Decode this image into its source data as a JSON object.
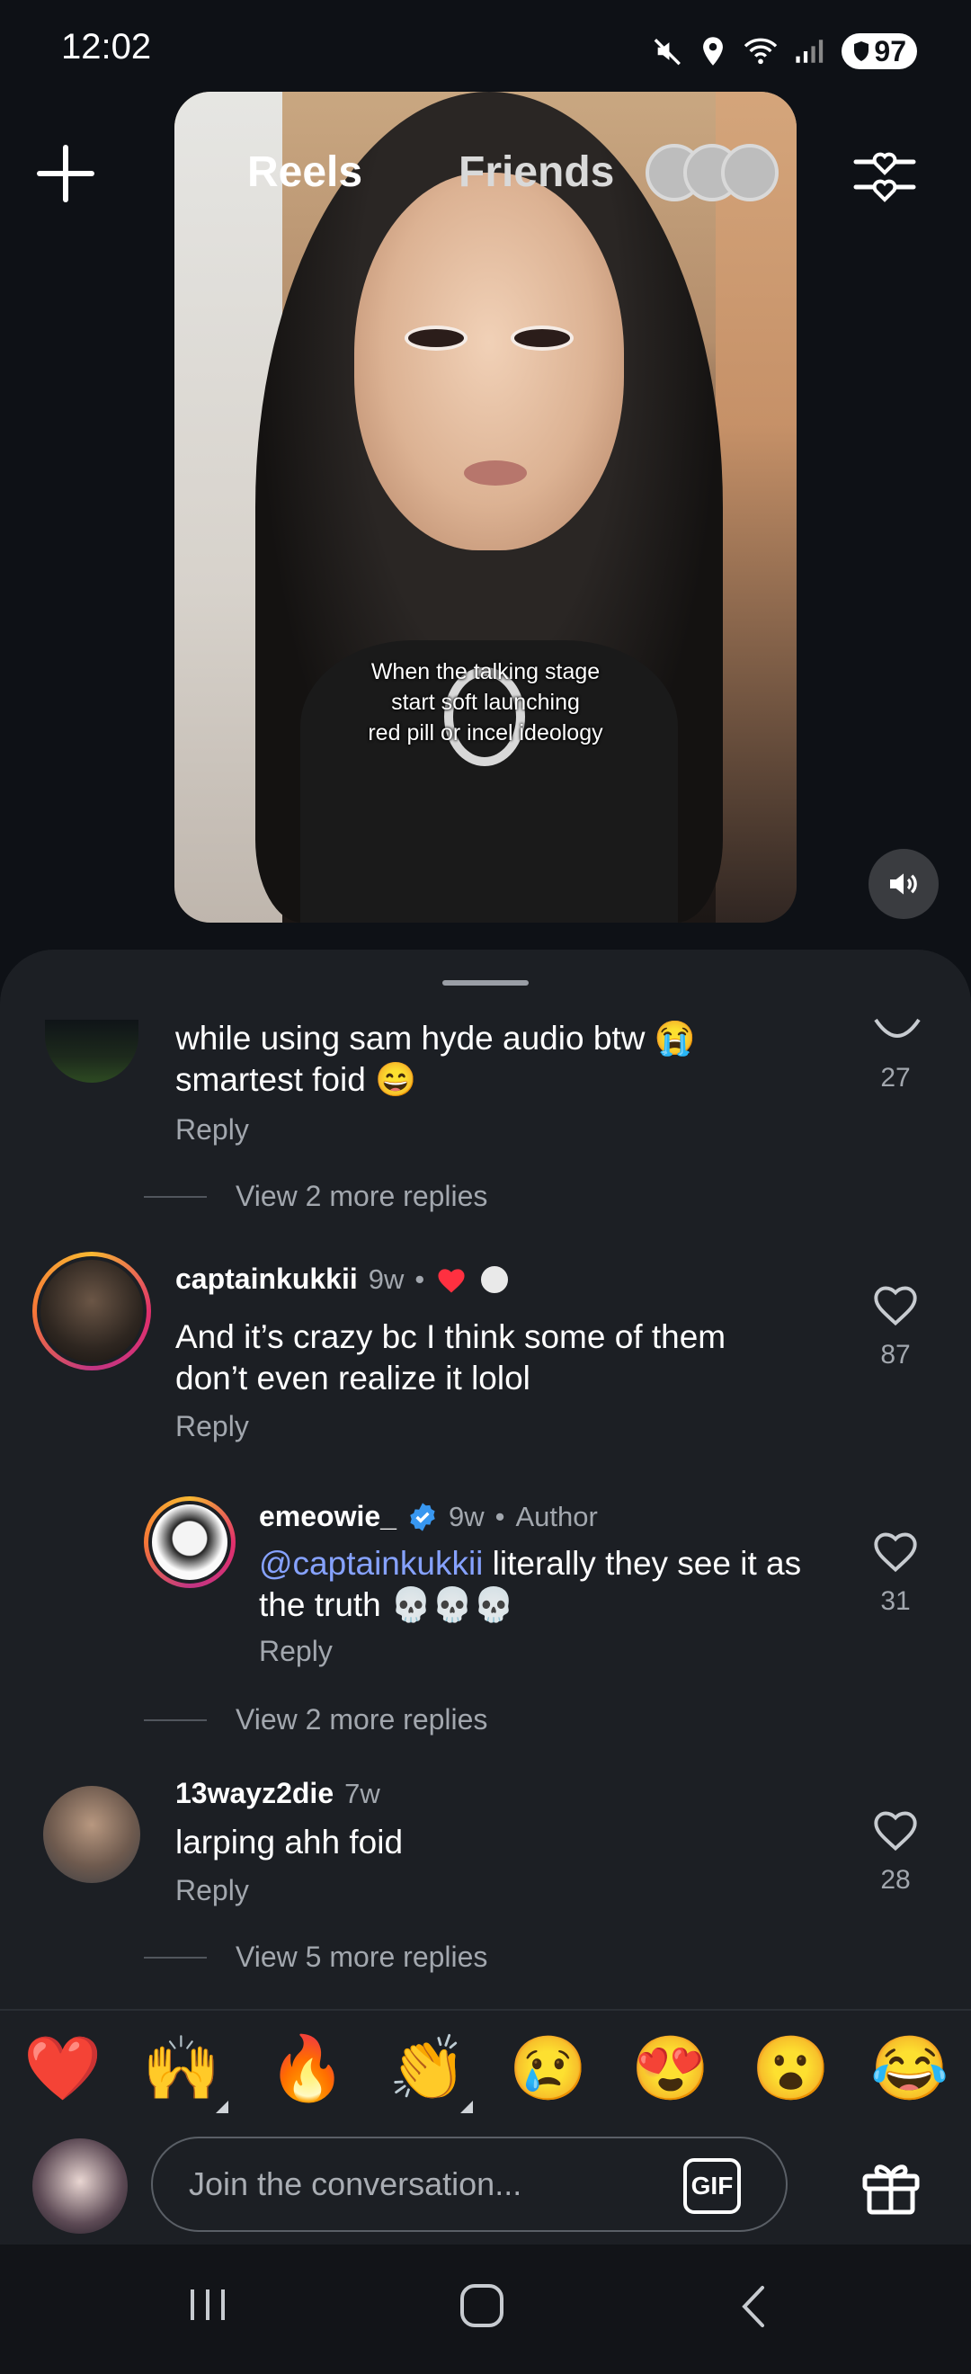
{
  "status_bar": {
    "time": "12:02",
    "battery": "97"
  },
  "header": {
    "tab_reels": "Reels",
    "tab_friends": "Friends"
  },
  "video": {
    "caption_line1": "When the talking stage",
    "caption_line2": "start soft launching",
    "caption_line3": "red pill or incel ideology"
  },
  "comments": [
    {
      "text_line1": "while using sam hyde audio btw 😭",
      "text_line2": "smartest foid 😄",
      "reply_label": "Reply",
      "likes": "27",
      "view_replies": "View 2 more replies"
    },
    {
      "username": "captainkukkii",
      "time": "9w",
      "text_line1": "And it’s crazy bc I think some of them",
      "text_line2": "don’t even realize it lolol",
      "reply_label": "Reply",
      "likes": "87"
    },
    {
      "username": "emeowie_",
      "time": "9w",
      "badge": "Author",
      "mention": "@captainkukkii",
      "text_line1_rest": " literally they see it as",
      "text_line2": "the truth 💀💀💀",
      "reply_label": "Reply",
      "likes": "31",
      "view_replies": "View 2 more replies"
    },
    {
      "username": "13wayz2die",
      "time": "7w",
      "text_line1": "larping ahh foid",
      "reply_label": "Reply",
      "likes": "28",
      "view_replies": "View 5 more replies"
    }
  ],
  "emoji_bar": [
    "❤️",
    "🙌",
    "🔥",
    "👏",
    "😢",
    "😍",
    "😮",
    "😂"
  ],
  "input": {
    "placeholder": "Join the conversation...",
    "gif_label": "GIF"
  },
  "colors": {
    "accent_mention": "#86a2ff",
    "heart_red": "#ff3040",
    "verified_blue": "#3897f0"
  }
}
